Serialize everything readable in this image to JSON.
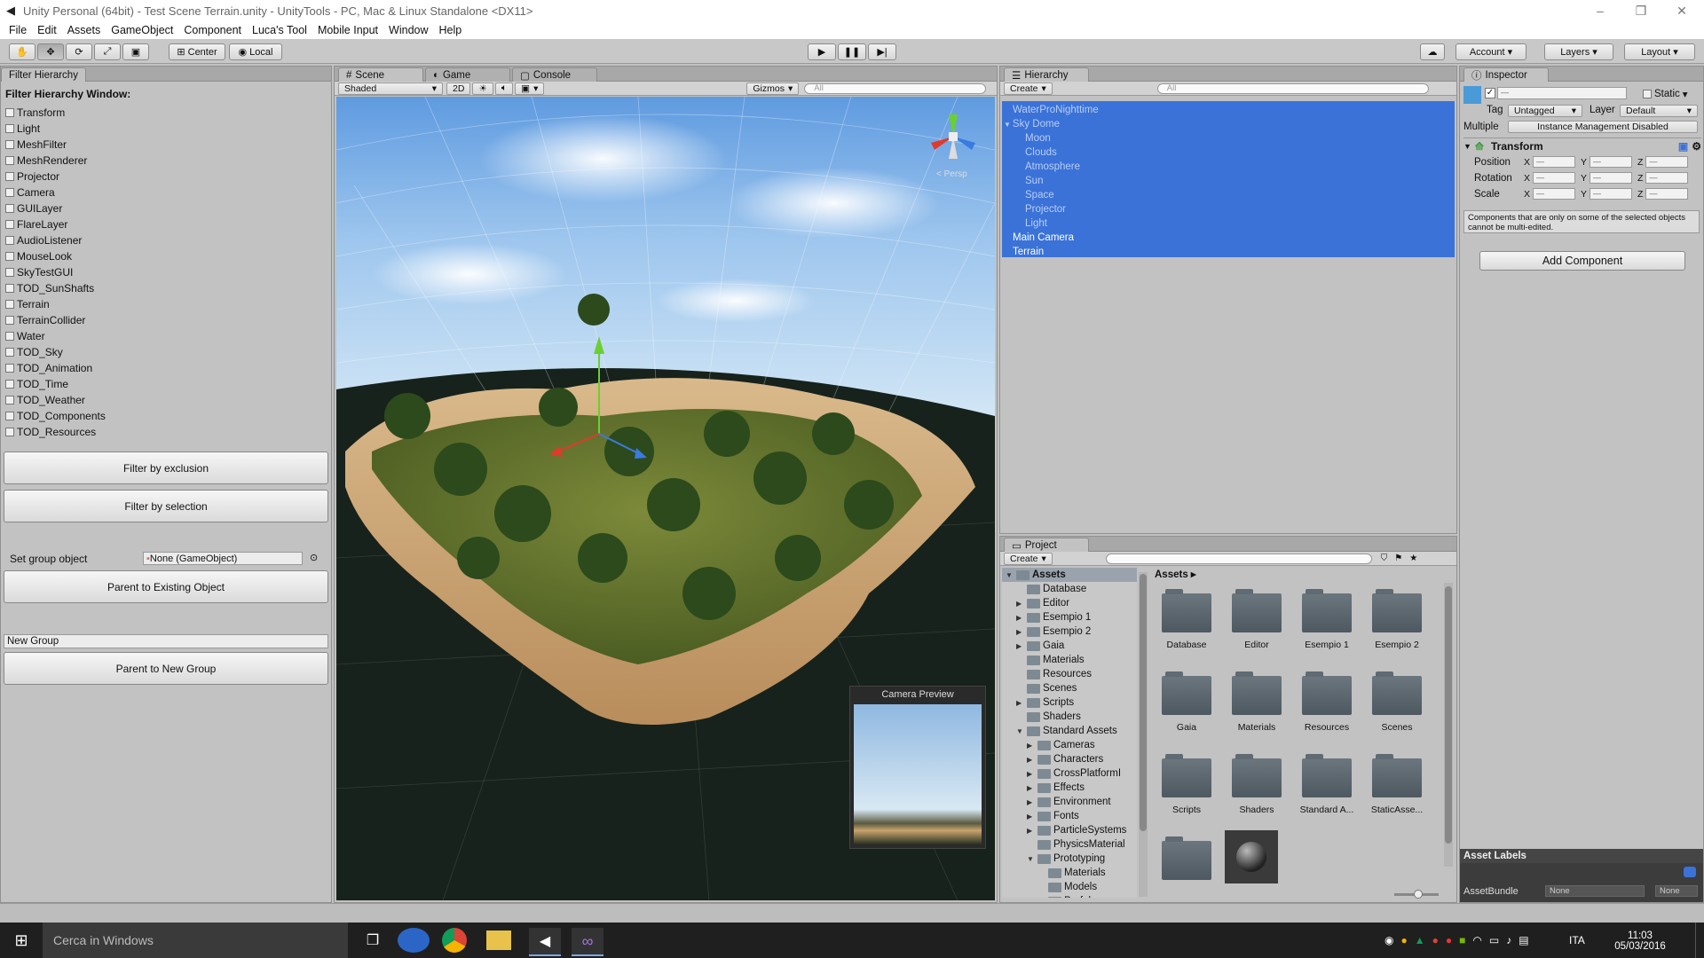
{
  "window": {
    "title": "Unity Personal (64bit) - Test Scene Terrain.unity - UnityTools - PC, Mac & Linux Standalone <DX11>"
  },
  "menu": [
    "File",
    "Edit",
    "Assets",
    "GameObject",
    "Component",
    "Luca's Tool",
    "Mobile Input",
    "Window",
    "Help"
  ],
  "toolbar": {
    "pivot_label": "Center",
    "space_label": "Local",
    "account_label": "Account",
    "layers_label": "Layers",
    "layout_label": "Layout"
  },
  "filter_hierarchy": {
    "tab": "Filter Hierarchy",
    "heading": "Filter Hierarchy Window:",
    "components": [
      "Transform",
      "Light",
      "MeshFilter",
      "MeshRenderer",
      "Projector",
      "Camera",
      "GUILayer",
      "FlareLayer",
      "AudioListener",
      "MouseLook",
      "SkyTestGUI",
      "TOD_SunShafts",
      "Terrain",
      "TerrainCollider",
      "Water",
      "TOD_Sky",
      "TOD_Animation",
      "TOD_Time",
      "TOD_Weather",
      "TOD_Components",
      "TOD_Resources"
    ],
    "filter_exclusion": "Filter by exclusion",
    "filter_selection": "Filter by selection",
    "set_group_label": "Set group object",
    "group_object_value": "None (GameObject)",
    "parent_existing": "Parent to Existing Object",
    "new_group_value": "New Group",
    "parent_new": "Parent to New Group"
  },
  "scene": {
    "tabs": [
      "Scene",
      "Game",
      "Console"
    ],
    "shading": "Shaded",
    "mode_2d": "2D",
    "gizmos": "Gizmos",
    "search_placeholder": "All",
    "persp_label": "Persp",
    "camera_preview": "Camera Preview"
  },
  "hierarchy": {
    "tab": "Hierarchy",
    "create": "Create",
    "search_placeholder": "All",
    "items": [
      {
        "label": "WaterProNighttime",
        "indent": 0,
        "dim": true
      },
      {
        "label": "Sky Dome",
        "indent": 0,
        "dim": true
      },
      {
        "label": "Moon",
        "indent": 1,
        "dim": true
      },
      {
        "label": "Clouds",
        "indent": 1,
        "dim": true
      },
      {
        "label": "Atmosphere",
        "indent": 1,
        "dim": true
      },
      {
        "label": "Sun",
        "indent": 1,
        "dim": true
      },
      {
        "label": "Space",
        "indent": 1,
        "dim": true
      },
      {
        "label": "Projector",
        "indent": 1,
        "dim": true
      },
      {
        "label": "Light",
        "indent": 1,
        "dim": true
      },
      {
        "label": "Main Camera",
        "indent": 0,
        "dim": false
      },
      {
        "label": "Terrain",
        "indent": 0,
        "dim": false
      }
    ]
  },
  "inspector": {
    "tab": "Inspector",
    "static_label": "Static",
    "tag_label": "Tag",
    "tag_value": "Untagged",
    "layer_label": "Layer",
    "layer_value": "Default",
    "multiple_label": "Multiple",
    "instance_mgmt": "Instance Management Disabled",
    "transform_label": "Transform",
    "position": "Position",
    "rotation": "Rotation",
    "scale": "Scale",
    "axes": [
      "X",
      "Y",
      "Z"
    ],
    "field_value": "—",
    "note": "Components that are only on some of the selected objects cannot be multi-edited.",
    "add_component": "Add Component",
    "asset_labels": "Asset Labels",
    "asset_bundle": "AssetBundle",
    "bundle_value": "None",
    "bundle_variant": "None"
  },
  "project": {
    "tab": "Project",
    "create": "Create",
    "root": "Assets",
    "breadcrumb": "Assets",
    "tree": [
      {
        "label": "Assets",
        "depth": 0,
        "arrow": "▼"
      },
      {
        "label": "Database",
        "depth": 1,
        "arrow": ""
      },
      {
        "label": "Editor",
        "depth": 1,
        "arrow": "▶"
      },
      {
        "label": "Esempio 1",
        "depth": 1,
        "arrow": "▶"
      },
      {
        "label": "Esempio 2",
        "depth": 1,
        "arrow": "▶"
      },
      {
        "label": "Gaia",
        "depth": 1,
        "arrow": "▶"
      },
      {
        "label": "Materials",
        "depth": 1,
        "arrow": ""
      },
      {
        "label": "Resources",
        "depth": 1,
        "arrow": ""
      },
      {
        "label": "Scenes",
        "depth": 1,
        "arrow": ""
      },
      {
        "label": "Scripts",
        "depth": 1,
        "arrow": "▶"
      },
      {
        "label": "Shaders",
        "depth": 1,
        "arrow": ""
      },
      {
        "label": "Standard Assets",
        "depth": 1,
        "arrow": "▼"
      },
      {
        "label": "Cameras",
        "depth": 2,
        "arrow": "▶"
      },
      {
        "label": "Characters",
        "depth": 2,
        "arrow": "▶"
      },
      {
        "label": "CrossPlatformI",
        "depth": 2,
        "arrow": "▶"
      },
      {
        "label": "Effects",
        "depth": 2,
        "arrow": "▶"
      },
      {
        "label": "Environment",
        "depth": 2,
        "arrow": "▶"
      },
      {
        "label": "Fonts",
        "depth": 2,
        "arrow": "▶"
      },
      {
        "label": "ParticleSystems",
        "depth": 2,
        "arrow": "▶"
      },
      {
        "label": "PhysicsMaterial",
        "depth": 2,
        "arrow": ""
      },
      {
        "label": "Prototyping",
        "depth": 2,
        "arrow": "▼"
      },
      {
        "label": "Materials",
        "depth": 3,
        "arrow": ""
      },
      {
        "label": "Models",
        "depth": 3,
        "arrow": ""
      },
      {
        "label": "Prefabs",
        "depth": 3,
        "arrow": ""
      }
    ],
    "grid": [
      "Database",
      "Editor",
      "Esempio 1",
      "Esempio 2",
      "Gaia",
      "Materials",
      "Resources",
      "Scenes",
      "Scripts",
      "Shaders",
      "Standard A...",
      "StaticAsse..."
    ]
  },
  "taskbar": {
    "search_placeholder": "Cerca in Windows",
    "language": "ITA",
    "time": "11:03",
    "date": "05/03/2016"
  },
  "colors": {
    "selection": "#3a72d8",
    "panel": "#c2c2c2",
    "taskbar": "#1f1f1f"
  }
}
